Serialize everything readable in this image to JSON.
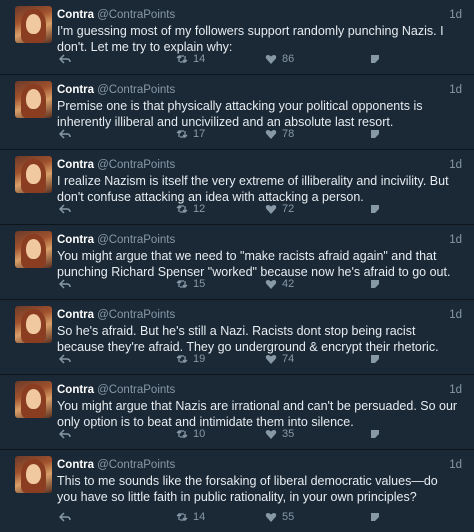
{
  "tweets": [
    {
      "name": "Contra",
      "handle": "@ContraPoints",
      "time": "1d",
      "text": "I'm guessing most of my followers support randomly punching Nazis. I don't. Let me try to explain why:",
      "retweets": "14",
      "likes": "86"
    },
    {
      "name": "Contra",
      "handle": "@ContraPoints",
      "time": "1d",
      "text": "Premise one is that physically attacking your political opponents is inherently illiberal and uncivilized and an absolute last resort.",
      "retweets": "17",
      "likes": "78"
    },
    {
      "name": "Contra",
      "handle": "@ContraPoints",
      "time": "1d",
      "text": "I realize Nazism is itself the very extreme of illiberality and incivility. But don't confuse attacking an idea with attacking a person.",
      "retweets": "12",
      "likes": "72"
    },
    {
      "name": "Contra",
      "handle": "@ContraPoints",
      "time": "1d",
      "text": "You might argue that we need to \"make racists afraid again\" and that punching Richard Spenser \"worked\" because now he's afraid to go out.",
      "retweets": "15",
      "likes": "42"
    },
    {
      "name": "Contra",
      "handle": "@ContraPoints",
      "time": "1d",
      "text": "So he's afraid. But he's still a Nazi. Racists dont stop being racist because they're afraid. They go underground & encrypt their rhetoric.",
      "retweets": "19",
      "likes": "74"
    },
    {
      "name": "Contra",
      "handle": "@ContraPoints",
      "time": "1d",
      "text": "You might argue that Nazis are irrational and can't be persuaded. So our only option is to beat and intimidate them into silence.",
      "retweets": "10",
      "likes": "35"
    },
    {
      "name": "Contra",
      "handle": "@ContraPoints",
      "time": "1d",
      "text": "This to me sounds like the forsaking of liberal democratic values—do you have so little faith in public rationality, in your own principles?",
      "retweets": "14",
      "likes": "55"
    }
  ],
  "icons": {
    "reply": "reply-icon",
    "retweet": "retweet-icon",
    "like": "heart-icon",
    "more": "more-icon"
  },
  "colors": {
    "background": "#1b2836",
    "text": "#e6ecf0",
    "muted": "#8899a6"
  }
}
